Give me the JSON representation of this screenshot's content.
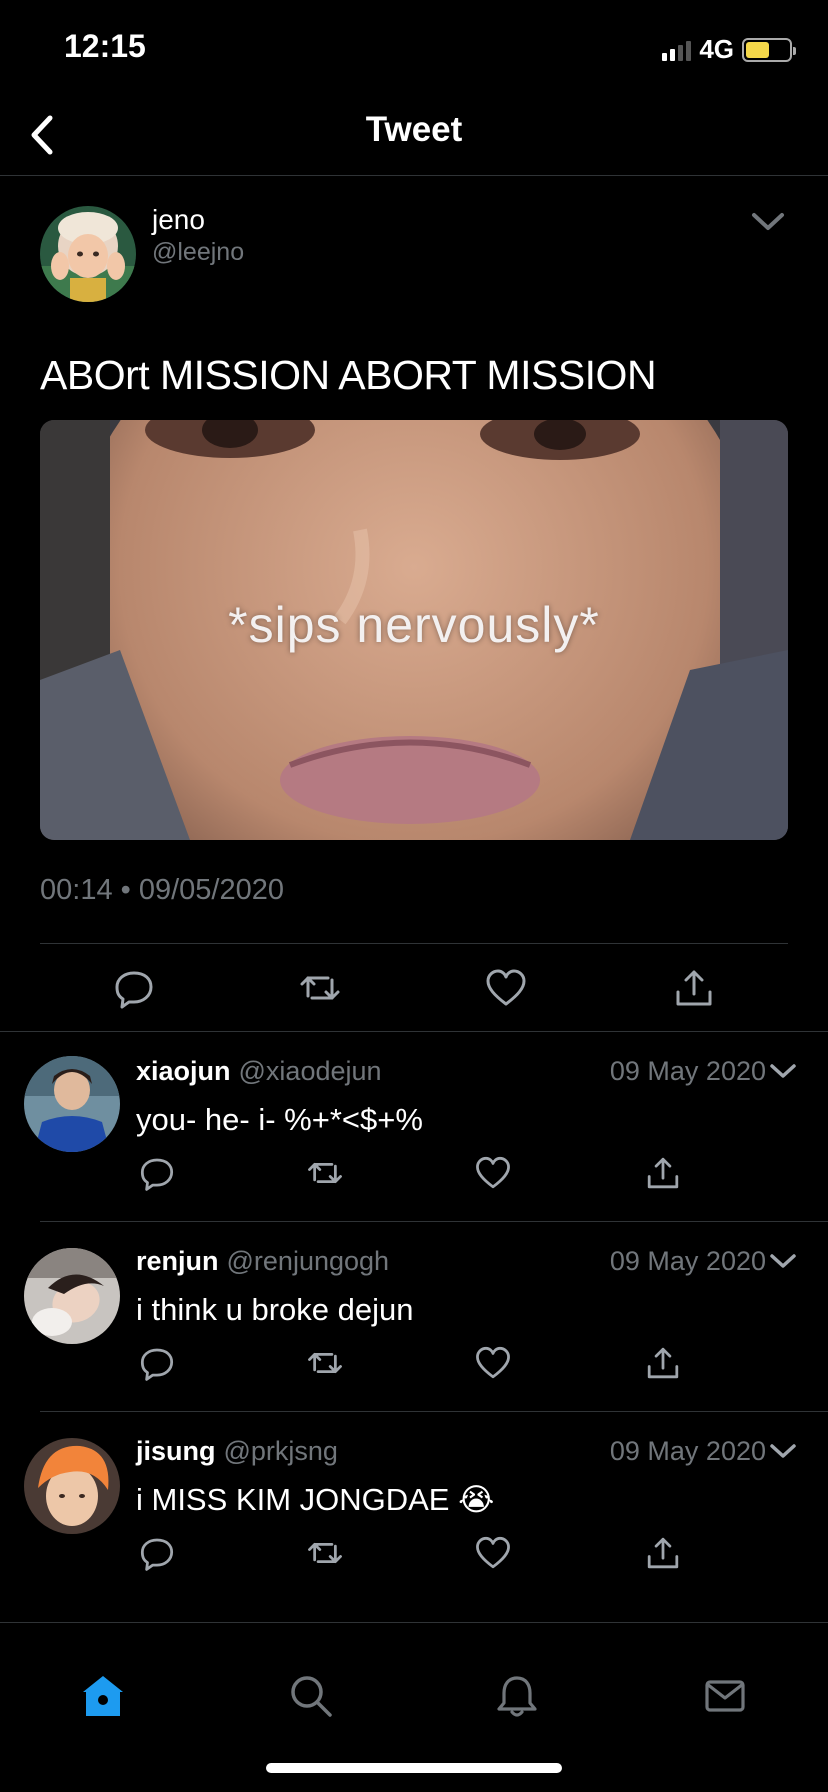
{
  "status_bar": {
    "time": "12:15",
    "network": "4G",
    "battery_color": "#f5d84a"
  },
  "header": {
    "title": "Tweet",
    "back_icon": "chevron-left-icon"
  },
  "main_tweet": {
    "author": {
      "name": "jeno",
      "handle": "@leejno"
    },
    "text": "ABOrt MISSION ABORT MISSION",
    "image_caption": "*sips nervously*",
    "timestamp": "00:14 • 09/05/2020",
    "actions": [
      "reply-icon",
      "retweet-icon",
      "like-icon",
      "share-icon"
    ]
  },
  "replies": [
    {
      "name": "xiaojun",
      "handle": "@xiaodejun",
      "date": "09 May 2020",
      "text": "you- he- i- %+*<$+%"
    },
    {
      "name": "renjun",
      "handle": "@renjungogh",
      "date": "09 May 2020",
      "text": "i think u broke dejun"
    },
    {
      "name": "jisung",
      "handle": "@prkjsng",
      "date": "09 May 2020",
      "text": "i MISS KIM JONGDAE 😭"
    }
  ],
  "tab_bar": {
    "tabs": [
      "home-icon",
      "search-icon",
      "notifications-icon",
      "messages-icon"
    ],
    "active_color": "#1d9bf0"
  },
  "colors": {
    "background": "#000000",
    "muted": "#71767b",
    "divider": "#2f3336"
  }
}
